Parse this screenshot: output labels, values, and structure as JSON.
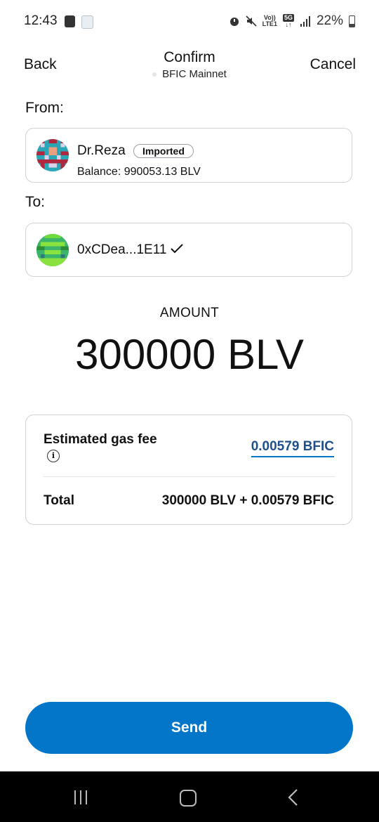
{
  "status_bar": {
    "time": "12:43",
    "volte": "Vo))",
    "lte": "LTE1",
    "network_type": "5G",
    "battery": "22%"
  },
  "header": {
    "back_label": "Back",
    "title": "Confirm",
    "network": "BFIC Mainnet",
    "cancel_label": "Cancel"
  },
  "from": {
    "label": "From:",
    "account_name": "Dr.Reza",
    "badge": "Imported",
    "balance": "Balance: 990053.13 BLV"
  },
  "to": {
    "label": "To:",
    "address": "0xCDea...1E11",
    "verified_icon": "checkmark-icon"
  },
  "amount": {
    "label": "AMOUNT",
    "value": "300000 BLV"
  },
  "fees": {
    "gas_label": "Estimated gas fee",
    "gas_value": "0.00579 BFIC",
    "total_label": "Total",
    "total_value": "300000 BLV + 0.00579 BFIC"
  },
  "actions": {
    "send_label": "Send"
  },
  "colors": {
    "primary": "#0376c9",
    "border": "#cfd3d8"
  }
}
